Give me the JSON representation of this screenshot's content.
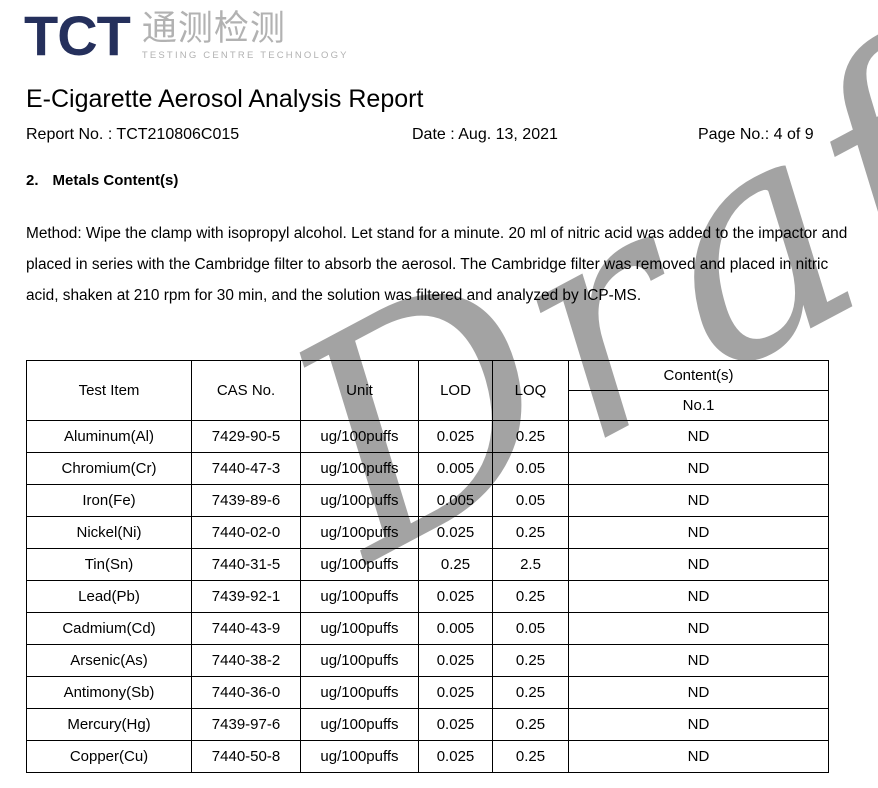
{
  "logo": {
    "mark": "TCT",
    "chinese": "通测检测",
    "tagline": "TESTING  CENTRE  TECHNOLOGY",
    "mark_color": "#25305c",
    "secondary_color": "#b2b2b2"
  },
  "header": {
    "title": "E-Cigarette Aerosol Analysis Report",
    "report_no": "Report No. : TCT210806C015",
    "date": "Date : Aug. 13, 2021",
    "page_no": "Page No.: 4 of 9"
  },
  "section": {
    "number": "2.",
    "title": "Metals Content(s)",
    "method": "Method: Wipe the clamp with isopropyl alcohol. Let stand for a minute. 20 ml of nitric acid was added to the impactor and placed in series with the Cambridge filter to absorb the aerosol. The Cambridge filter was removed and placed in nitric acid, shaken at 210 rpm for 30 min, and the solution was filtered and analyzed by ICP-MS."
  },
  "watermark": {
    "text": "Draft",
    "color": "#8a8a8a"
  },
  "table": {
    "columns": [
      "Test Item",
      "CAS No.",
      "Unit",
      "LOD",
      "LOQ"
    ],
    "content_group_header": "Content(s)",
    "content_sub_header": "No.1",
    "rows": [
      {
        "test_item": "Aluminum(Al)",
        "cas_no": "7429-90-5",
        "unit": "ug/100puffs",
        "lod": "0.025",
        "loq": "0.25",
        "no1": "ND"
      },
      {
        "test_item": "Chromium(Cr)",
        "cas_no": "7440-47-3",
        "unit": "ug/100puffs",
        "lod": "0.005",
        "loq": "0.05",
        "no1": "ND"
      },
      {
        "test_item": "Iron(Fe)",
        "cas_no": "7439-89-6",
        "unit": "ug/100puffs",
        "lod": "0.005",
        "loq": "0.05",
        "no1": "ND"
      },
      {
        "test_item": "Nickel(Ni)",
        "cas_no": "7440-02-0",
        "unit": "ug/100puffs",
        "lod": "0.025",
        "loq": "0.25",
        "no1": "ND"
      },
      {
        "test_item": "Tin(Sn)",
        "cas_no": "7440-31-5",
        "unit": "ug/100puffs",
        "lod": "0.25",
        "loq": "2.5",
        "no1": "ND"
      },
      {
        "test_item": "Lead(Pb)",
        "cas_no": "7439-92-1",
        "unit": "ug/100puffs",
        "lod": "0.025",
        "loq": "0.25",
        "no1": "ND"
      },
      {
        "test_item": "Cadmium(Cd)",
        "cas_no": "7440-43-9",
        "unit": "ug/100puffs",
        "lod": "0.005",
        "loq": "0.05",
        "no1": "ND"
      },
      {
        "test_item": "Arsenic(As)",
        "cas_no": "7440-38-2",
        "unit": "ug/100puffs",
        "lod": "0.025",
        "loq": "0.25",
        "no1": "ND"
      },
      {
        "test_item": "Antimony(Sb)",
        "cas_no": "7440-36-0",
        "unit": "ug/100puffs",
        "lod": "0.025",
        "loq": "0.25",
        "no1": "ND"
      },
      {
        "test_item": "Mercury(Hg)",
        "cas_no": "7439-97-6",
        "unit": "ug/100puffs",
        "lod": "0.025",
        "loq": "0.25",
        "no1": "ND"
      },
      {
        "test_item": "Copper(Cu)",
        "cas_no": "7440-50-8",
        "unit": "ug/100puffs",
        "lod": "0.025",
        "loq": "0.25",
        "no1": "ND"
      }
    ]
  }
}
